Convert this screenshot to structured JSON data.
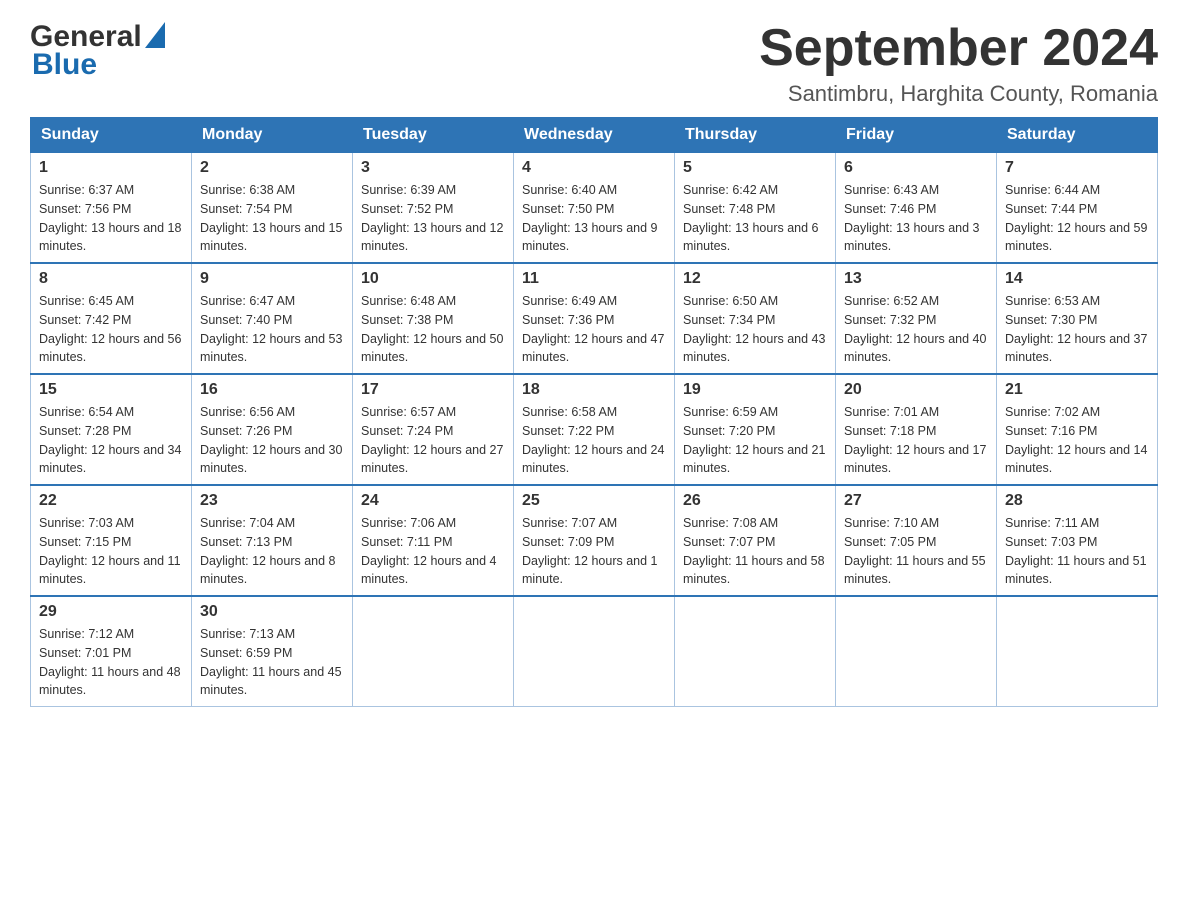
{
  "header": {
    "logo_general": "General",
    "logo_blue": "Blue",
    "title": "September 2024",
    "subtitle": "Santimbru, Harghita County, Romania"
  },
  "days_of_week": [
    "Sunday",
    "Monday",
    "Tuesday",
    "Wednesday",
    "Thursday",
    "Friday",
    "Saturday"
  ],
  "weeks": [
    [
      {
        "date": "1",
        "sunrise": "6:37 AM",
        "sunset": "7:56 PM",
        "daylight": "13 hours and 18 minutes."
      },
      {
        "date": "2",
        "sunrise": "6:38 AM",
        "sunset": "7:54 PM",
        "daylight": "13 hours and 15 minutes."
      },
      {
        "date": "3",
        "sunrise": "6:39 AM",
        "sunset": "7:52 PM",
        "daylight": "13 hours and 12 minutes."
      },
      {
        "date": "4",
        "sunrise": "6:40 AM",
        "sunset": "7:50 PM",
        "daylight": "13 hours and 9 minutes."
      },
      {
        "date": "5",
        "sunrise": "6:42 AM",
        "sunset": "7:48 PM",
        "daylight": "13 hours and 6 minutes."
      },
      {
        "date": "6",
        "sunrise": "6:43 AM",
        "sunset": "7:46 PM",
        "daylight": "13 hours and 3 minutes."
      },
      {
        "date": "7",
        "sunrise": "6:44 AM",
        "sunset": "7:44 PM",
        "daylight": "12 hours and 59 minutes."
      }
    ],
    [
      {
        "date": "8",
        "sunrise": "6:45 AM",
        "sunset": "7:42 PM",
        "daylight": "12 hours and 56 minutes."
      },
      {
        "date": "9",
        "sunrise": "6:47 AM",
        "sunset": "7:40 PM",
        "daylight": "12 hours and 53 minutes."
      },
      {
        "date": "10",
        "sunrise": "6:48 AM",
        "sunset": "7:38 PM",
        "daylight": "12 hours and 50 minutes."
      },
      {
        "date": "11",
        "sunrise": "6:49 AM",
        "sunset": "7:36 PM",
        "daylight": "12 hours and 47 minutes."
      },
      {
        "date": "12",
        "sunrise": "6:50 AM",
        "sunset": "7:34 PM",
        "daylight": "12 hours and 43 minutes."
      },
      {
        "date": "13",
        "sunrise": "6:52 AM",
        "sunset": "7:32 PM",
        "daylight": "12 hours and 40 minutes."
      },
      {
        "date": "14",
        "sunrise": "6:53 AM",
        "sunset": "7:30 PM",
        "daylight": "12 hours and 37 minutes."
      }
    ],
    [
      {
        "date": "15",
        "sunrise": "6:54 AM",
        "sunset": "7:28 PM",
        "daylight": "12 hours and 34 minutes."
      },
      {
        "date": "16",
        "sunrise": "6:56 AM",
        "sunset": "7:26 PM",
        "daylight": "12 hours and 30 minutes."
      },
      {
        "date": "17",
        "sunrise": "6:57 AM",
        "sunset": "7:24 PM",
        "daylight": "12 hours and 27 minutes."
      },
      {
        "date": "18",
        "sunrise": "6:58 AM",
        "sunset": "7:22 PM",
        "daylight": "12 hours and 24 minutes."
      },
      {
        "date": "19",
        "sunrise": "6:59 AM",
        "sunset": "7:20 PM",
        "daylight": "12 hours and 21 minutes."
      },
      {
        "date": "20",
        "sunrise": "7:01 AM",
        "sunset": "7:18 PM",
        "daylight": "12 hours and 17 minutes."
      },
      {
        "date": "21",
        "sunrise": "7:02 AM",
        "sunset": "7:16 PM",
        "daylight": "12 hours and 14 minutes."
      }
    ],
    [
      {
        "date": "22",
        "sunrise": "7:03 AM",
        "sunset": "7:15 PM",
        "daylight": "12 hours and 11 minutes."
      },
      {
        "date": "23",
        "sunrise": "7:04 AM",
        "sunset": "7:13 PM",
        "daylight": "12 hours and 8 minutes."
      },
      {
        "date": "24",
        "sunrise": "7:06 AM",
        "sunset": "7:11 PM",
        "daylight": "12 hours and 4 minutes."
      },
      {
        "date": "25",
        "sunrise": "7:07 AM",
        "sunset": "7:09 PM",
        "daylight": "12 hours and 1 minute."
      },
      {
        "date": "26",
        "sunrise": "7:08 AM",
        "sunset": "7:07 PM",
        "daylight": "11 hours and 58 minutes."
      },
      {
        "date": "27",
        "sunrise": "7:10 AM",
        "sunset": "7:05 PM",
        "daylight": "11 hours and 55 minutes."
      },
      {
        "date": "28",
        "sunrise": "7:11 AM",
        "sunset": "7:03 PM",
        "daylight": "11 hours and 51 minutes."
      }
    ],
    [
      {
        "date": "29",
        "sunrise": "7:12 AM",
        "sunset": "7:01 PM",
        "daylight": "11 hours and 48 minutes."
      },
      {
        "date": "30",
        "sunrise": "7:13 AM",
        "sunset": "6:59 PM",
        "daylight": "11 hours and 45 minutes."
      },
      null,
      null,
      null,
      null,
      null
    ]
  ],
  "labels": {
    "sunrise": "Sunrise:",
    "sunset": "Sunset:",
    "daylight": "Daylight:"
  }
}
